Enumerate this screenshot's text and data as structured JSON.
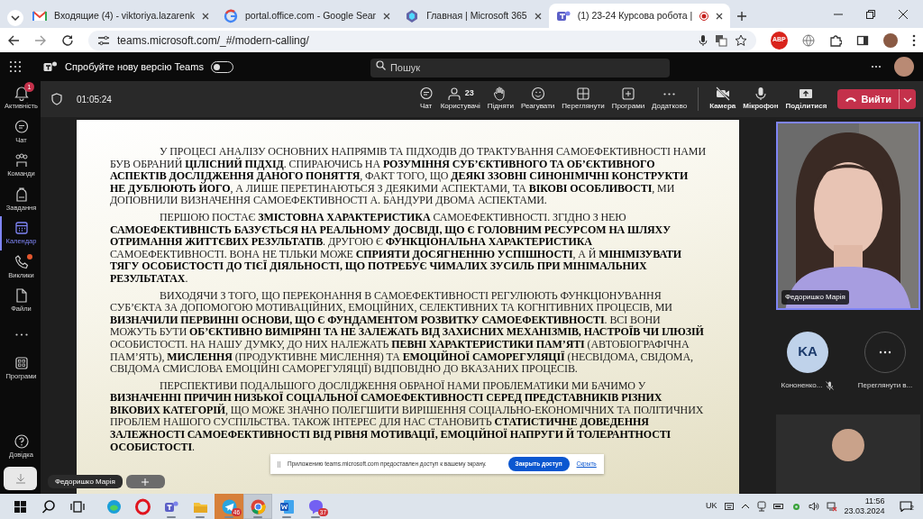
{
  "browser": {
    "tabs": [
      {
        "title": "Входящие (4) - viktoriya.lazarenk",
        "kind": "gmail",
        "selected": false
      },
      {
        "title": "portal.office.com - Google Sear",
        "kind": "google",
        "selected": false
      },
      {
        "title": "Главная | Microsoft 365",
        "kind": "m365",
        "selected": false
      },
      {
        "title": "(1) 23-24 Курсова робота |",
        "kind": "teams",
        "selected": true
      }
    ],
    "url": "teams.microsoft.com/_#/modern-calling/",
    "extension_label": "ABP"
  },
  "teams_header": {
    "promo_text": "Спробуйте нову версію Teams",
    "new_teams_toggle": {
      "on": false
    },
    "search_placeholder": "Пошук"
  },
  "rail": [
    {
      "kind": "bell",
      "label": "Активність",
      "selected": false,
      "alert": false,
      "badge": "1"
    },
    {
      "kind": "chat",
      "label": "Чат",
      "selected": false,
      "alert": false
    },
    {
      "kind": "teams",
      "label": "Команди",
      "selected": false,
      "alert": false
    },
    {
      "kind": "bag",
      "label": "Завдання",
      "selected": false,
      "alert": false
    },
    {
      "kind": "calendar",
      "label": "Календар",
      "selected": true,
      "alert": false
    },
    {
      "kind": "phone",
      "label": "Виклики",
      "selected": false,
      "alert": true
    },
    {
      "kind": "file",
      "label": "Файли",
      "selected": false,
      "alert": false
    },
    {
      "kind": "more",
      "selected": false,
      "alert": false
    },
    {
      "kind": "apps",
      "label": "Програми",
      "selected": false,
      "alert": false
    }
  ],
  "rail_help": {
    "label": "Довідка"
  },
  "meeting_toolbar": {
    "timer": "01:05:24",
    "actions": [
      {
        "kind": "chat",
        "label": "Чат"
      },
      {
        "kind": "people",
        "label": "Користувачі",
        "count": "23"
      },
      {
        "kind": "hand",
        "label": "Підняти"
      },
      {
        "kind": "smile",
        "label": "Реагувати"
      },
      {
        "kind": "grid",
        "label": "Переглянути"
      },
      {
        "kind": "plus",
        "label": "Програми"
      },
      {
        "kind": "dots",
        "label": "Додатково"
      }
    ],
    "devices": [
      {
        "kind": "camera",
        "label": "Камера",
        "on": false
      },
      {
        "kind": "mic",
        "label": "Мікрофон",
        "on": true
      },
      {
        "kind": "share",
        "label": "Поділитися",
        "on": true
      }
    ],
    "leave_label": "Вийти"
  },
  "slide": {
    "paragraphs": [
      "У ПРОЦЕСІ АНАЛІЗУ ОСНОВНИХ НАПРЯМІВ ТА ПІДХОДІВ ДО ТРАКТУВАННЯ САМОЕФЕКТИВНОСТІ НАМИ БУВ ОБРАНИЙ **ЦІЛІСНИЙ ПІДХІД**. СПИРАЮЧИСЬ НА **РОЗУМІННЯ СУБ’ЄКТИВНОГО ТА ОБ’ЄКТИВНОГО АСПЕКТІВ ДОСЛІДЖЕННЯ ДАНОГО ПОНЯТТЯ**, ФАКТ ТОГО, ЩО **ДЕЯКІ ЗЗОВНІ СИНОНІМІЧНІ КОНСТРУКТИ НЕ ДУБЛЮЮТЬ ЙОГО**, А ЛИШЕ ПЕРЕТИНАЮТЬСЯ З ДЕЯКИМИ АСПЕКТАМИ, ТА **ВІКОВІ ОСОБЛИВОСТІ**, МИ ДОПОВНИЛИ ВИЗНАЧЕННЯ САМОЕФЕКТИВНОСТІ А. БАНДУРИ ДВОМА АСПЕКТАМИ.",
      "ПЕРШОЮ ПОСТАЄ **ЗМІСТОВНА ХАРАКТЕРИСТИКА** САМОЕФЕКТИВНОСТІ. ЗГІДНО З НЕЮ **САМОЕФЕКТИВНІСТЬ БАЗУЄТЬСЯ НА РЕАЛЬНОМУ ДОСВІДІ, ЩО Є ГОЛОВНИМ РЕСУРСОМ НА ШЛЯХУ ОТРИМАННЯ ЖИТТЄВИХ РЕЗУЛЬТАТІВ**. ДРУГОЮ Є **ФУНКЦІОНАЛЬНА ХАРАКТЕРИСТИКА** САМОЕФЕКТИВНОСТІ. ВОНА НЕ ТІЛЬКИ МОЖЕ **СПРИЯТИ ДОСЯГНЕННЮ УСПІШНОСТІ**, А Й **МІНІМІЗУВАТИ ТЯГУ ОСОБИСТОСТІ ДО ТІЄЇ ДІЯЛЬНОСТІ, ЩО ПОТРЕБУЄ ЧИМАЛИХ ЗУСИЛЬ ПРИ МІНІМАЛЬНИХ РЕЗУЛЬТАТАХ**.",
      "ВИХОДЯЧИ З ТОГО, ЩО ПЕРЕКОНАННЯ В САМОЕФЕКТИВНОСТІ РЕГУЛЮЮТЬ ФУНКЦІОНУВАННЯ СУБ’ЄКТА ЗА ДОПОМОГОЮ МОТИВАЦІЙНИХ, ЕМОЦІЙНИХ, СЕЛЕКТИВНИХ ТА КОГНІТИВНИХ ПРОЦЕСІВ, МИ **ВИЗНАЧИЛИ ПЕРВИННІ ОСНОВИ, ЩО Є ФУНДАМЕНТОМ РОЗВИТКУ САМОЕФЕКТИВНОСТІ**. ВСІ ВОНИ МОЖУТЬ БУТИ **ОБ’ЄКТИВНО ВИМІРЯНІ ТА НЕ ЗАЛЕЖАТЬ ВІД ЗАХИСНИХ МЕХАНІЗМІВ, НАСТРОЇВ ЧИ ІЛЮЗІЙ** ОСОБИСТОСТІ. НА НАШУ ДУМКУ, ДО НИХ НАЛЕЖАТЬ **ПЕВНІ ХАРАКТЕРИСТИКИ ПАМ’ЯТІ** (АВТОБІОГРАФІЧНА ПАМ’ЯТЬ), **МИСЛЕННЯ** (ПРОДУКТИВНЕ МИСЛЕННЯ) ТА **ЕМОЦІЙНОЇ САМОРЕГУЛЯЦІЇ** (НЕСВІДОМА, СВІДОМА, СВІДОМА СМИСЛОВА ЕМОЦІЙНІ САМОРЕГУЛЯЦІЇ) ВІДПОВІДНО ДО ВКАЗАНИХ ПРОЦЕСІВ.",
      "ПЕРСПЕКТИВИ ПОДАЛЬШОГО ДОСЛІДЖЕННЯ ОБРАНОЇ НАМИ ПРОБЛЕМАТИКИ МИ БАЧИМО У **ВИЗНАЧЕННІ ПРИЧИН НИЗЬКОЇ СОЦІАЛЬНОЇ САМОЕФЕКТИВНОСТІ СЕРЕД ПРЕДСТАВНИКІВ РІЗНИХ ВІКОВИХ КАТЕГОРІЙ**, ЩО МОЖЕ ЗНАЧНО ПОЛЕГШИТИ ВИРІШЕННЯ СОЦІАЛЬНО-ЕКОНОМІЧНИХ ТА ПОЛІТИЧНИХ ПРОБЛЕМ НАШОГО СУСПІЛЬСТВА. ТАКОЖ ІНТЕРЕС ДЛЯ НАС СТАНОВИТЬ **СТАТИСТИЧНЕ ДОВЕДЕННЯ ЗАЛЕЖНОСТІ САМОЕФЕКТИВНОСТІ ВІД РІВНЯ МОТИВАЦІЇ, ЕМОЦІЙНОЇ НАПРУГИ Й ТОЛЕРАНТНОСТІ ОСОБИСТОСТІ**."
    ]
  },
  "stage_label": {
    "name": "Федоришко Марія"
  },
  "share_banner": {
    "text": "Приложению teams.microsoft.com предоставлен доступ к вашему экрану.",
    "stop_label": "Закрыть доступ",
    "hide_label": "Скрыть"
  },
  "participants": {
    "main_tile": {
      "name": "Федоришко Марія",
      "selected": true
    },
    "others": [
      {
        "initials": "KA",
        "name": "Кононенко...",
        "muted": true
      }
    ],
    "more_label": "Переглянути в..."
  },
  "taskbar": {
    "apps": [
      {
        "kind": "start",
        "running": false,
        "selected": false,
        "flashing": false
      },
      {
        "kind": "search",
        "running": false,
        "selected": false,
        "flashing": false
      },
      {
        "kind": "taskview",
        "running": false,
        "selected": false,
        "flashing": false
      },
      {
        "kind": "edge",
        "running": false,
        "selected": false,
        "flashing": false
      },
      {
        "kind": "opera",
        "running": false,
        "selected": false,
        "flashing": false
      },
      {
        "kind": "teams",
        "running": true,
        "selected": false,
        "flashing": false
      },
      {
        "kind": "explorer",
        "running": true,
        "selected": false,
        "flashing": false
      },
      {
        "kind": "telegram",
        "running": true,
        "selected": false,
        "flashing": true,
        "badge": "46"
      },
      {
        "kind": "chrome",
        "running": true,
        "selected": true,
        "flashing": false
      },
      {
        "kind": "word",
        "running": true,
        "selected": false,
        "flashing": false
      },
      {
        "kind": "viber",
        "running": true,
        "selected": false,
        "flashing": false,
        "badge": "37"
      }
    ],
    "language": "UK",
    "time": "11:56",
    "date": "23.03.2024",
    "notification_count": "2"
  }
}
